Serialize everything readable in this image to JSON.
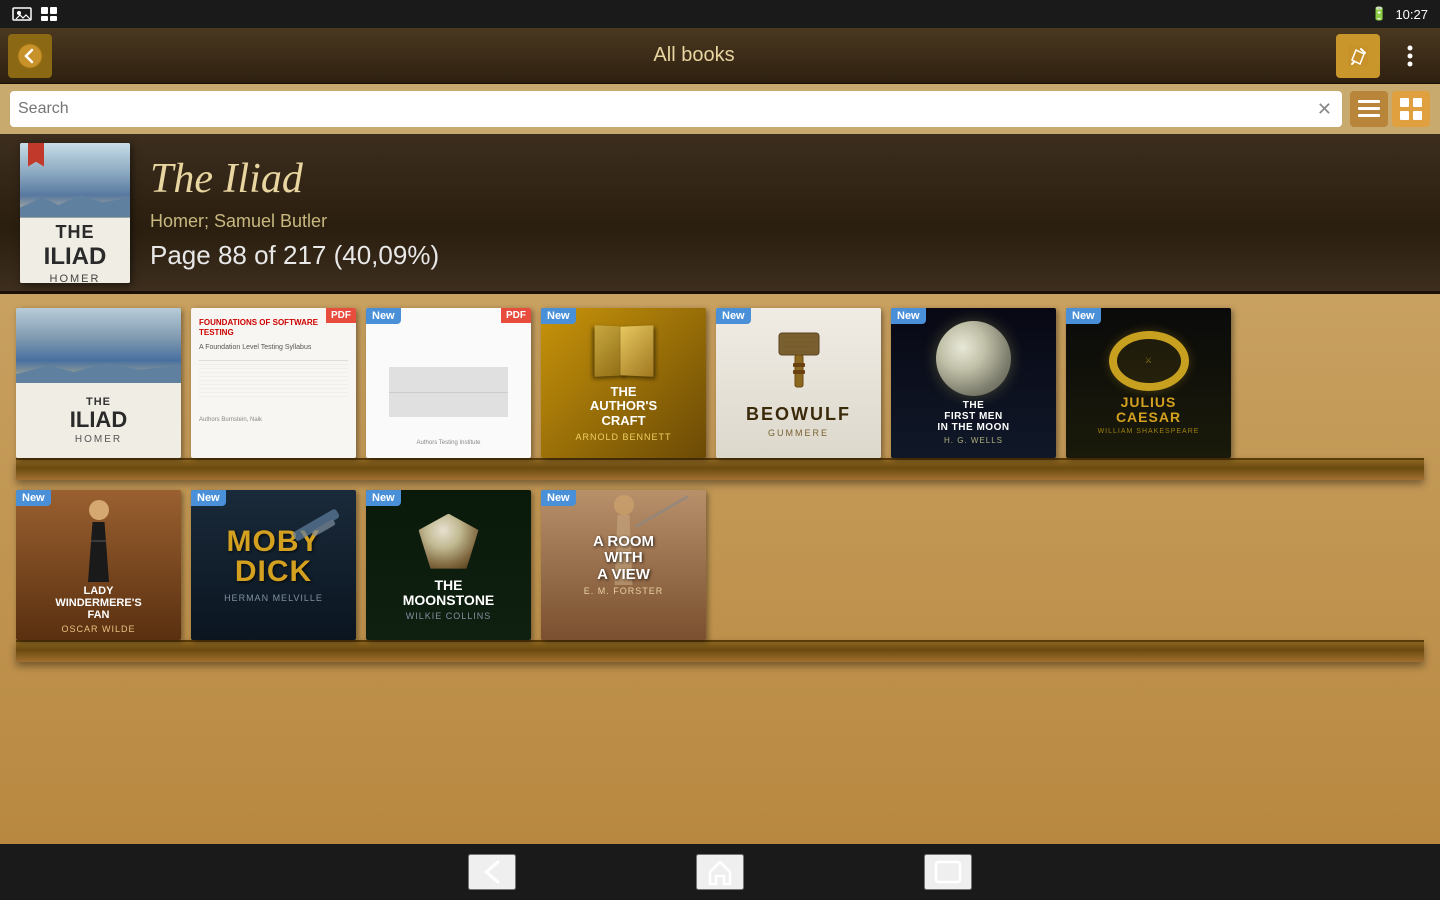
{
  "statusBar": {
    "time": "10:27",
    "icons": [
      "grid-icon",
      "battery-icon"
    ]
  },
  "toolbar": {
    "title": "All books",
    "backLabel": "←",
    "editLabel": "✎",
    "menuLabel": "⋮"
  },
  "search": {
    "placeholder": "Search",
    "value": "",
    "listViewLabel": "≡",
    "gridViewLabel": "⊞"
  },
  "currentBook": {
    "title": "The Iliad",
    "author": "Homer; Samuel Butler",
    "progress": "Page 88 of 217 (40,09%)"
  },
  "shelf1": {
    "books": [
      {
        "id": "iliad",
        "badge": null,
        "isPdf": false,
        "title": "THE ILIAD",
        "sub": "HOMER"
      },
      {
        "id": "foundations",
        "badge": null,
        "isPdf": true,
        "title": "FOUNDATIONS OF SOFTWARE TESTING",
        "sub": ""
      },
      {
        "id": "whitepaper",
        "badge": "New",
        "isPdf": true,
        "title": "",
        "sub": ""
      },
      {
        "id": "authors-craft",
        "badge": "New",
        "isPdf": false,
        "title": "THE AUTHOR'S CRAFT",
        "sub": "ARNOLD BENNETT"
      },
      {
        "id": "beowulf",
        "badge": "New",
        "isPdf": false,
        "title": "BEOWULF",
        "sub": "GUMMERE"
      },
      {
        "id": "first-men",
        "badge": "New",
        "isPdf": false,
        "title": "THE FIRST MEN IN THE MOON",
        "sub": "H. G. WELLS"
      },
      {
        "id": "julius-caesar",
        "badge": "New",
        "isPdf": false,
        "title": "JULIUS CAESAR",
        "sub": "WILLIAM SHAKESPEARE"
      }
    ]
  },
  "shelf2": {
    "books": [
      {
        "id": "lady-windermere",
        "badge": "New",
        "isPdf": false,
        "title": "LADY WINDERMERE'S FAN",
        "sub": "OSCAR WILDE"
      },
      {
        "id": "moby-dick",
        "badge": "New",
        "isPdf": false,
        "title": "MOBY DICK",
        "sub": "HERMAN MELVILLE"
      },
      {
        "id": "moonstone",
        "badge": "New",
        "isPdf": false,
        "title": "THE MOONSTONE",
        "sub": "WILKIE COLLINS"
      },
      {
        "id": "room-with-view",
        "badge": "New",
        "isPdf": false,
        "title": "A ROOM WITH A VIEW",
        "sub": "E. M. FORSTER"
      }
    ]
  },
  "navBar": {
    "backLabel": "←",
    "homeLabel": "⌂",
    "recentLabel": "▭"
  }
}
